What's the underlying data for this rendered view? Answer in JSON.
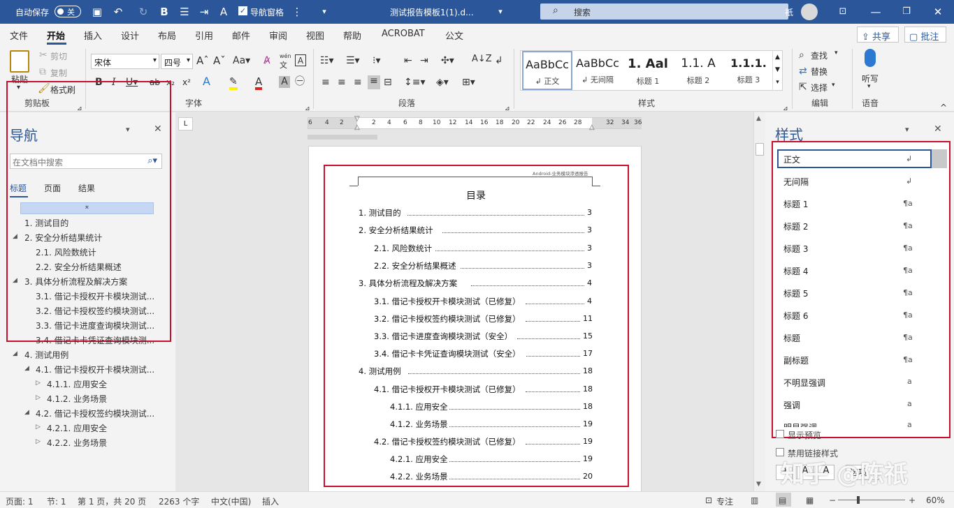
{
  "titlebar": {
    "autosave_label": "自动保存",
    "autosave_state": "关",
    "nav_pane_label": "导航窗格",
    "doc_title": "测试报告模板1(1).d...",
    "search_placeholder": "搜索",
    "user_name": "祇"
  },
  "menu": [
    "文件",
    "开始",
    "插入",
    "设计",
    "布局",
    "引用",
    "邮件",
    "审阅",
    "视图",
    "帮助",
    "ACROBAT",
    "公文"
  ],
  "menu_right": {
    "share": "共享",
    "comment": "批注"
  },
  "ribbon": {
    "clipboard": {
      "paste": "粘贴",
      "cut": "剪切",
      "copy": "复制",
      "format_painter": "格式刷",
      "group": "剪贴板"
    },
    "font": {
      "name": "宋体",
      "size": "四号",
      "group": "字体",
      "pinyin": "wén"
    },
    "paragraph": {
      "group": "段落"
    },
    "styles": {
      "group": "样式",
      "gallery": [
        {
          "preview": "AaBbCc",
          "name": "↲ 正文"
        },
        {
          "preview": "AaBbCc",
          "name": "↲ 无间隔"
        },
        {
          "preview": "1. Aal",
          "name": "标题 1"
        },
        {
          "preview": "1.1. A",
          "name": "标题 2"
        },
        {
          "preview": "1.1.1.",
          "name": "标题 3"
        }
      ]
    },
    "editing": {
      "find": "查找",
      "replace": "替换",
      "select": "选择",
      "group": "编辑"
    },
    "voice": {
      "dictate": "听写",
      "group": "语音"
    }
  },
  "nav": {
    "title": "导航",
    "search_placeholder": "在文档中搜索",
    "tabs": [
      "标题",
      "页面",
      "结果"
    ],
    "items": [
      {
        "text": "1. 测试目的"
      },
      {
        "text": "2. 安全分析结果统计"
      },
      {
        "text": "2.1. 风险数统计"
      },
      {
        "text": "2.2. 安全分析结果概述"
      },
      {
        "text": "3. 具体分析流程及解决方案"
      },
      {
        "text": "3.1. 借记卡授权开卡模块测试..."
      },
      {
        "text": "3.2. 借记卡授权签约模块测试..."
      },
      {
        "text": "3.3. 借记卡进度查询模块测试..."
      },
      {
        "text": "3.4. 借记卡卡凭证查询模块测..."
      },
      {
        "text": "4. 测试用例"
      },
      {
        "text": "4.1. 借记卡授权开卡模块测试..."
      },
      {
        "text": "4.1.1. 应用安全"
      },
      {
        "text": "4.1.2. 业务场景"
      },
      {
        "text": "4.2. 借记卡授权签约模块测试..."
      },
      {
        "text": "4.2.1. 应用安全"
      },
      {
        "text": "4.2.2. 业务场景"
      }
    ]
  },
  "ruler": [
    "6",
    "4",
    "2",
    "2",
    "4",
    "6",
    "8",
    "10",
    "12",
    "14",
    "16",
    "18",
    "20",
    "22",
    "24",
    "26",
    "28",
    "32",
    "34",
    "36"
  ],
  "document": {
    "header_text": "Android-业务模块渗透报告",
    "toc_title": "目录",
    "toc": [
      {
        "text": "1.  测试目的",
        "page": "3"
      },
      {
        "text": "2.  安全分析结果统计",
        "page": "3"
      },
      {
        "text": "2.1.  风险数统计",
        "page": "3"
      },
      {
        "text": "2.2.  安全分析结果概述",
        "page": "3"
      },
      {
        "text": "3.  具体分析流程及解决方案",
        "page": "4"
      },
      {
        "text": "3.1.  借记卡授权开卡模块测试（已修复）",
        "page": "4"
      },
      {
        "text": "3.2.  借记卡授权签约模块测试（已修复）",
        "page": "11"
      },
      {
        "text": "3.3.  借记卡进度查询模块测试（安全）",
        "page": "15"
      },
      {
        "text": "3.4.  借记卡卡凭证查询模块测试（安全）",
        "page": "17"
      },
      {
        "text": "4.  测试用例",
        "page": "18"
      },
      {
        "text": "4.1.  借记卡授权开卡模块测试（已修复）",
        "page": "18"
      },
      {
        "text": "4.1.1.  应用安全",
        "page": "18"
      },
      {
        "text": "4.1.2.  业务场景",
        "page": "19"
      },
      {
        "text": "4.2.  借记卡授权签约模块测试（已修复）",
        "page": "19"
      },
      {
        "text": "4.2.1.  应用安全",
        "page": "19"
      },
      {
        "text": "4.2.2.  业务场景",
        "page": "20"
      }
    ]
  },
  "styles_pane": {
    "title": "样式",
    "items": [
      {
        "name": "正文",
        "mark": "↲"
      },
      {
        "name": "无间隔",
        "mark": "↲"
      },
      {
        "name": "标题 1",
        "mark": "¶a"
      },
      {
        "name": "标题 2",
        "mark": "¶a"
      },
      {
        "name": "标题 3",
        "mark": "¶a"
      },
      {
        "name": "标题 4",
        "mark": "¶a"
      },
      {
        "name": "标题 5",
        "mark": "¶a"
      },
      {
        "name": "标题 6",
        "mark": "¶a"
      },
      {
        "name": "标题",
        "mark": "¶a"
      },
      {
        "name": "副标题",
        "mark": "¶a"
      },
      {
        "name": "不明显强调",
        "mark": "a"
      },
      {
        "name": "强调",
        "mark": "a"
      },
      {
        "name": "明显强调",
        "mark": "a"
      }
    ],
    "show_preview": "显示预览",
    "disable_linked": "禁用链接样式",
    "options_button": "选项..."
  },
  "statusbar": {
    "page": "页面: 1",
    "section": "节: 1",
    "page_of": "第 1 页，共 20 页",
    "words": "2263 个字",
    "language": "中文(中国)",
    "mode": "插入",
    "focus": "专注",
    "zoom": "60%"
  },
  "watermark": "知乎 @陈祇"
}
